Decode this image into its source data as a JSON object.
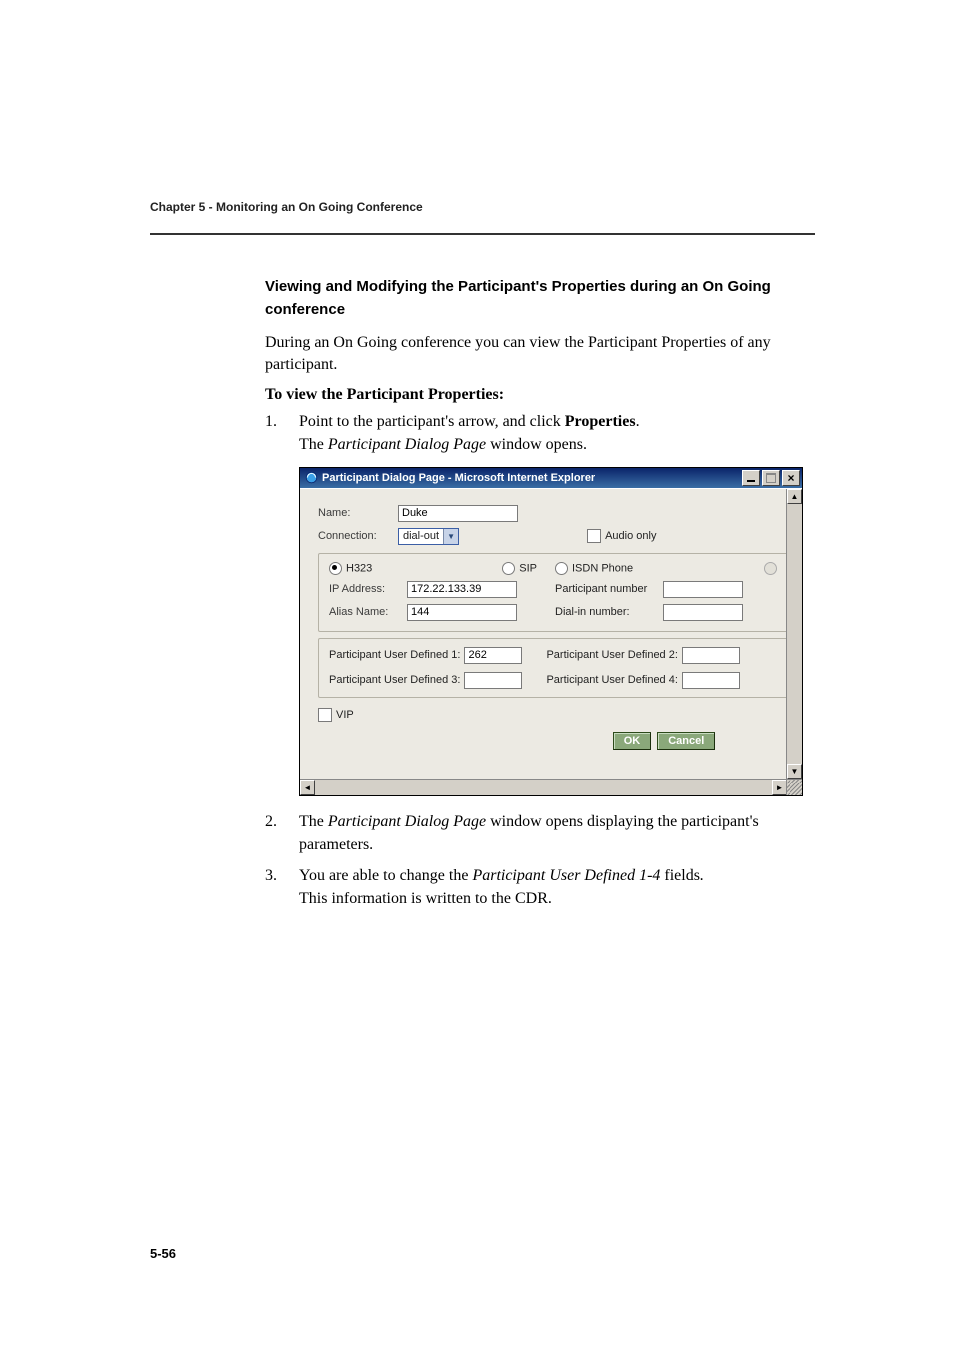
{
  "chapter_header": "Chapter 5 - Monitoring an On Going Conference",
  "page_number": "5-56",
  "section_title": "Viewing and Modifying the Participant's Properties during an On Going conference",
  "intro": "During an On Going conference you can view the Participant Properties of any participant.",
  "to_view_heading": "To view the Participant Properties:",
  "step1": {
    "num": "1.",
    "line1_pre": "Point to the participant's arrow, and click ",
    "line1_bold": "Properties",
    "line1_post": ".",
    "line2_pre": "The ",
    "line2_em": "Participant Dialog Page",
    "line2_post": " window opens."
  },
  "step2": {
    "num": "2.",
    "pre": "The ",
    "em": "Participant Dialog Page",
    "post": " window opens displaying the participant's parameters."
  },
  "step3": {
    "num": "3.",
    "pre": "You are able to change the ",
    "em": "Participant User Defined 1-4",
    "post1": " fields",
    "post2": ".",
    "line2": "This information is written to the CDR."
  },
  "shot": {
    "title": "Participant Dialog Page - Microsoft Internet Explorer",
    "labels": {
      "name": "Name:",
      "connection": "Connection:",
      "audio_only": "Audio only",
      "h323": "H323",
      "sip": "SIP",
      "isdn": "ISDN Phone",
      "ip_address": "IP Address:",
      "alias_name": "Alias Name:",
      "participant_number": "Participant number",
      "dial_in_number": "Dial-in number:",
      "pud1": "Participant User Defined 1:",
      "pud2": "Participant User Defined 2:",
      "pud3": "Participant User Defined 3:",
      "pud4": "Participant User Defined 4:",
      "vip": "VIP",
      "ok": "OK",
      "cancel": "Cancel"
    },
    "values": {
      "name": "Duke",
      "connection": "dial-out",
      "ip_address": "172.22.133.39",
      "alias_name": "144",
      "pud1": "262",
      "pud2": "",
      "pud3": "",
      "pud4": "",
      "participant_number": "",
      "dial_in_number": ""
    }
  }
}
